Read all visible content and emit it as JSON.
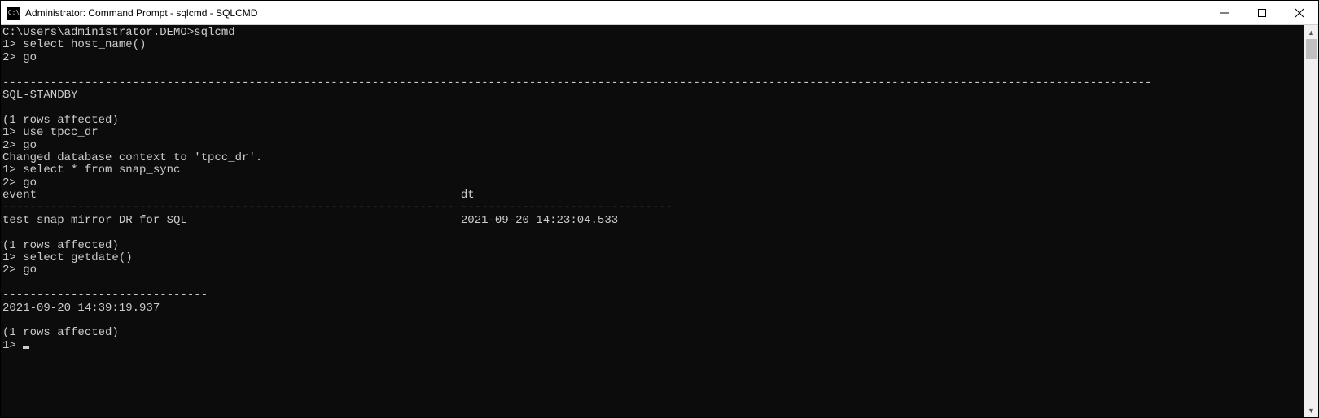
{
  "titlebar": {
    "icon_label": "C:\\",
    "title": "Administrator: Command Prompt - sqlcmd - SQLCMD"
  },
  "terminal": {
    "lines": [
      "C:\\Users\\administrator.DEMO>sqlcmd",
      "1> select host_name()",
      "2> go",
      "",
      "------------------------------------------------------------------------------------------------------------------------------------------------------------------------",
      "SQL-STANDBY",
      "",
      "(1 rows affected)",
      "1> use tpcc_dr",
      "2> go",
      "Changed database context to 'tpcc_dr'.",
      "1> select * from snap_sync",
      "2> go",
      "event                                                              dt",
      "------------------------------------------------------------------ -------------------------------",
      "test snap mirror DR for SQL                                        2021-09-20 14:23:04.533",
      "",
      "(1 rows affected)",
      "1> select getdate()",
      "2> go",
      "",
      "------------------------------",
      "2021-09-20 14:39:19.937",
      "",
      "(1 rows affected)",
      "1> "
    ]
  }
}
